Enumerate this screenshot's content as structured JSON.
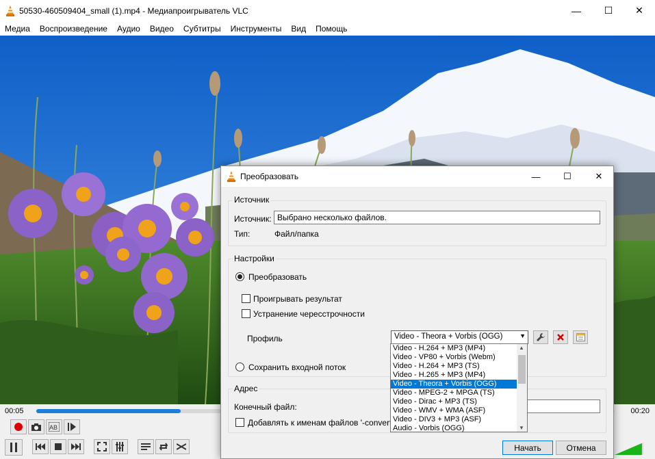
{
  "window": {
    "title": "50530-460509404_small (1).mp4 - Медиапроигрыватель VLC",
    "controls": {
      "minimize": "—",
      "maximize": "☐",
      "close": "✕"
    }
  },
  "menu": [
    "Медиа",
    "Воспроизведение",
    "Аудио",
    "Видео",
    "Субтитры",
    "Инструменты",
    "Вид",
    "Помощь"
  ],
  "playback": {
    "elapsed": "00:05",
    "total": "00:20",
    "progress_fraction": 0.25,
    "volume_fraction": 0.95,
    "accent": "#1b7ed8"
  },
  "icons": {
    "record": "record-icon",
    "snapshot": "camera-icon",
    "loop_ab": "loop-ab-icon",
    "frame": "frame-step-icon",
    "pause": "pause-icon",
    "prev": "previous-icon",
    "stop": "stop-icon",
    "next": "next-icon",
    "fullscreen": "fullscreen-icon",
    "extended": "extended-settings-icon",
    "playlist": "playlist-icon",
    "loop": "loop-icon",
    "shuffle": "shuffle-icon"
  },
  "dialog": {
    "title": "Преобразовать",
    "source_group": "Источник",
    "source_label": "Источник:",
    "source_value": "Выбрано несколько файлов.",
    "type_label": "Тип:",
    "type_value": "Файл/папка",
    "settings_group": "Настройки",
    "convert_label": "Преобразовать",
    "play_result_label": "Проигрывать результат",
    "deinterlace_label": "Устранение чересстрочности",
    "profile_label": "Профиль",
    "profile_selected": "Video - Theora + Vorbis (OGG)",
    "profile_options": [
      "Video - H.264 + MP3 (MP4)",
      "Video - VP80 + Vorbis (Webm)",
      "Video - H.264 + MP3 (TS)",
      "Video - H.265 + MP3 (MP4)",
      "Video - Theora + Vorbis (OGG)",
      "Video - MPEG-2 + MPGA (TS)",
      "Video - Dirac + MP3 (TS)",
      "Video - WMV + WMA (ASF)",
      "Video - DIV3 + MP3 (ASF)",
      "Audio - Vorbis (OGG)"
    ],
    "selected_index": 4,
    "dump_label": "Сохранить входной поток",
    "address_group": "Адрес",
    "dest_label": "Конечный файл:",
    "append_label": "Добавлять к именам файлов '-converted'",
    "start_button": "Начать",
    "cancel_button": "Отмена",
    "delete_color": "#d40000"
  }
}
